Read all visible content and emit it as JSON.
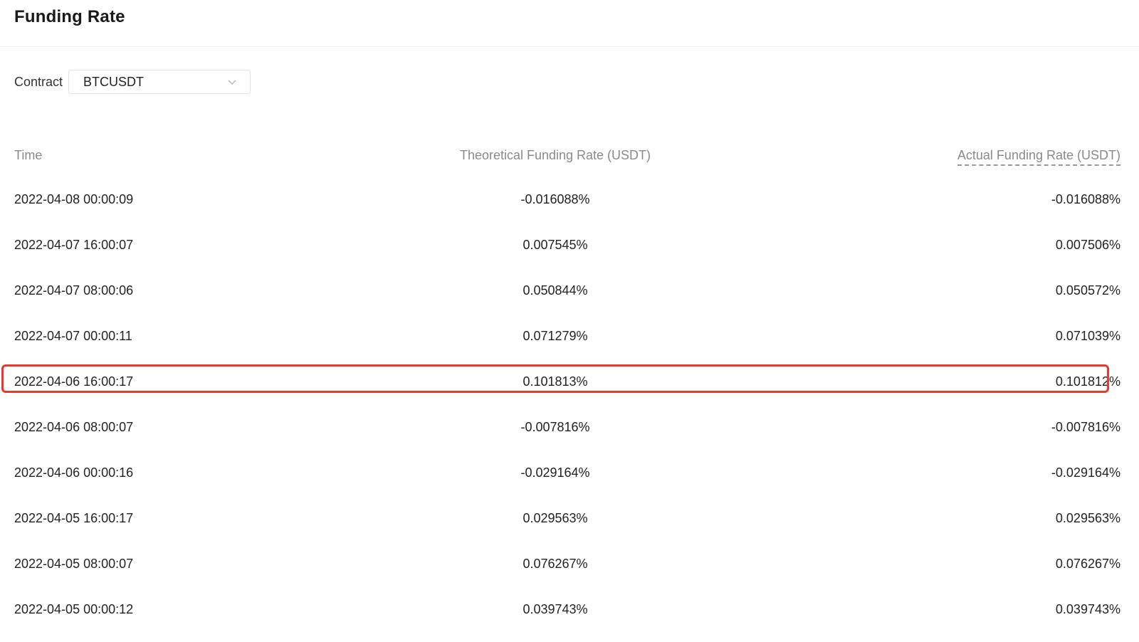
{
  "header": {
    "title": "Funding Rate"
  },
  "filter": {
    "contract_label": "Contract",
    "contract_value": "BTCUSDT"
  },
  "table": {
    "columns": {
      "time": "Time",
      "theoretical": "Theoretical Funding Rate (USDT)",
      "actual": "Actual Funding Rate (USDT)"
    },
    "rows": [
      {
        "time": "2022-04-08 00:00:09",
        "theoretical": "-0.016088%",
        "actual": "-0.016088%"
      },
      {
        "time": "2022-04-07 16:00:07",
        "theoretical": "0.007545%",
        "actual": "0.007506%"
      },
      {
        "time": "2022-04-07 08:00:06",
        "theoretical": "0.050844%",
        "actual": "0.050572%"
      },
      {
        "time": "2022-04-07 00:00:11",
        "theoretical": "0.071279%",
        "actual": "0.071039%"
      },
      {
        "time": "2022-04-06 16:00:17",
        "theoretical": "0.101813%",
        "actual": "0.101812%"
      },
      {
        "time": "2022-04-06 08:00:07",
        "theoretical": "-0.007816%",
        "actual": "-0.007816%"
      },
      {
        "time": "2022-04-06 00:00:16",
        "theoretical": "-0.029164%",
        "actual": "-0.029164%"
      },
      {
        "time": "2022-04-05 16:00:17",
        "theoretical": "0.029563%",
        "actual": "0.029563%"
      },
      {
        "time": "2022-04-05 08:00:07",
        "theoretical": "0.076267%",
        "actual": "0.076267%"
      },
      {
        "time": "2022-04-05 00:00:12",
        "theoretical": "0.039743%",
        "actual": "0.039743%"
      }
    ]
  },
  "highlight": {
    "row_index": 4,
    "color": "#e8392c"
  },
  "icons": {
    "contract_select": "chevron-down-icon"
  }
}
